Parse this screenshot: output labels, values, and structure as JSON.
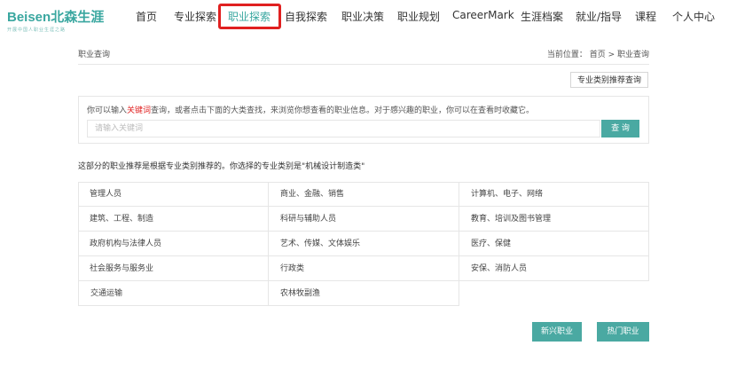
{
  "header": {
    "logo_main": "Beisen北森生涯",
    "logo_sub": "开展中国人职业生涯之路",
    "brand_color": "#3aa7a0",
    "nav": [
      {
        "label": "首页"
      },
      {
        "label": "专业探索"
      },
      {
        "label": "职业探索",
        "active": true
      },
      {
        "label": "自我探索"
      },
      {
        "label": "职业决策"
      },
      {
        "label": "职业规划"
      },
      {
        "label": "CareerMark"
      },
      {
        "label": "生涯档案"
      },
      {
        "label": "就业/指导"
      },
      {
        "label": "课程"
      },
      {
        "label": "个人中心"
      }
    ]
  },
  "breadcrumb": {
    "title": "职业查询",
    "location": "当前位置：  首页 > 职业查询"
  },
  "recommend_button": "专业类别推荐查询",
  "search": {
    "hint_before": "你可以输入",
    "hint_keyword": "关键词",
    "hint_after": "查询，或者点击下面的大类查找，来浏览你想查看的职业信息。对于感兴趣的职业，你可以在查看时收藏它。",
    "placeholder": "请输入关键词",
    "button": "查 询"
  },
  "info_text": "这部分的职业推荐是根据专业类别推荐的。你选择的专业类别是\"机械设计制造类\"",
  "categories": [
    [
      "管理人员",
      "商业、金融、销售",
      "计算机、电子、网络"
    ],
    [
      "建筑、工程、制造",
      "科研与辅助人员",
      "教育、培训及图书管理"
    ],
    [
      "政府机构与法律人员",
      "艺术、传媒、文体娱乐",
      "医疗、保健"
    ],
    [
      "社会服务与服务业",
      "行政类",
      "安保、消防人员"
    ],
    [
      "交通运输",
      "农林牧副渔"
    ]
  ],
  "actions": {
    "new_jobs": "新兴职业",
    "hot_jobs": "热门职业"
  },
  "accent_color": "#4aa9a2",
  "highlight_color": "#e02020"
}
